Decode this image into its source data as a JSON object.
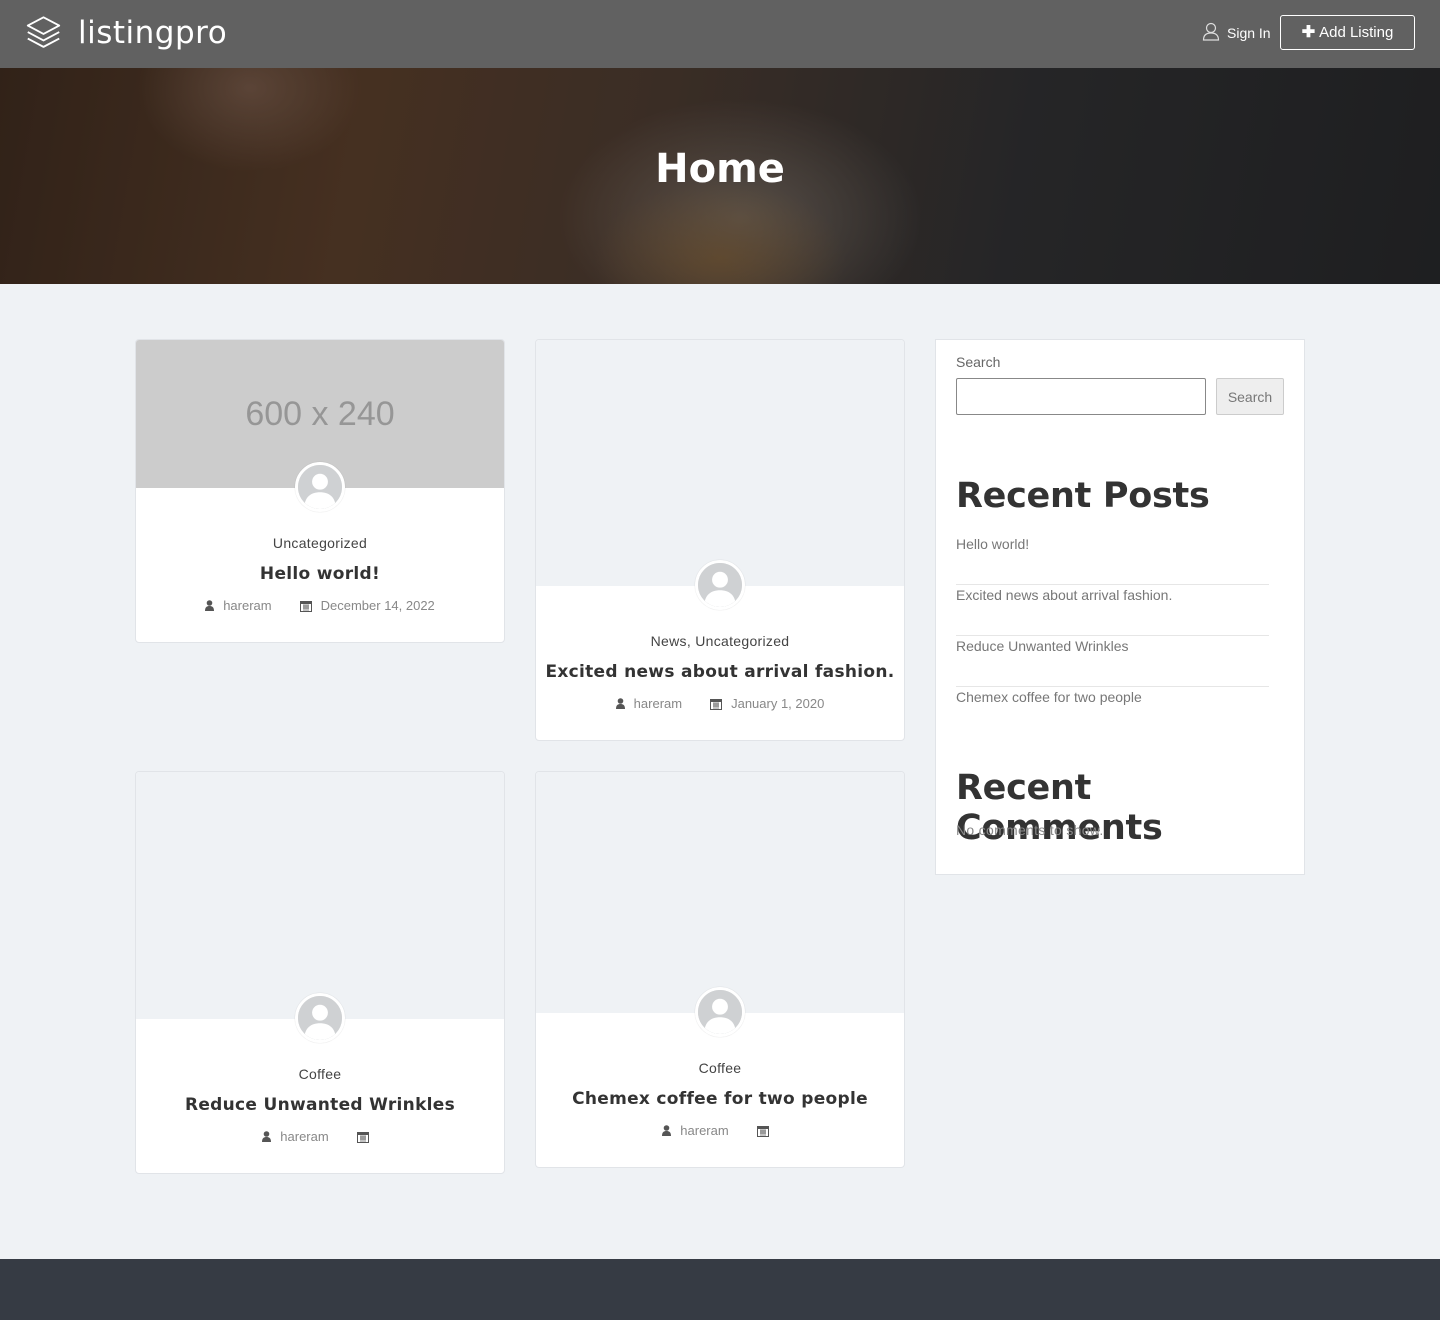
{
  "header": {
    "logo_text": "listingpro",
    "signin_label": "Sign In",
    "add_listing_label": "Add Listing"
  },
  "hero": {
    "title": "Home"
  },
  "posts": [
    {
      "categories": "Uncategorized",
      "title": "Hello world!",
      "author": "hareram",
      "date": "December 14, 2022",
      "thumb_text": "600 x 240"
    },
    {
      "categories": "News, Uncategorized",
      "title": "Excited news about arrival fashion.",
      "author": "hareram",
      "date": "January 1, 2020"
    },
    {
      "categories": "Coffee",
      "title": "Reduce Unwanted Wrinkles",
      "author": "hareram",
      "date": ""
    },
    {
      "categories": "Coffee",
      "title": "Chemex coffee for two people",
      "author": "hareram",
      "date": ""
    }
  ],
  "sidebar": {
    "search_label": "Search",
    "search_value": "",
    "search_button": "Search",
    "recent_posts_title": "Recent Posts",
    "recent_posts": [
      "Hello world!",
      "Excited news about arrival fashion.",
      "Reduce Unwanted Wrinkles",
      "Chemex coffee for two people"
    ],
    "recent_comments_title": "Recent Comments",
    "no_comments": "No comments to show."
  },
  "icons": {
    "logo": "layers-icon",
    "signin": "user-outline-icon",
    "author": "user-icon",
    "date": "calendar-icon",
    "avatar": "default-avatar-icon"
  },
  "colors": {
    "header_bg": "#616161",
    "page_bg": "#eff2f5",
    "footer_bg": "#363b44",
    "placeholder_bg": "#cccccc"
  }
}
